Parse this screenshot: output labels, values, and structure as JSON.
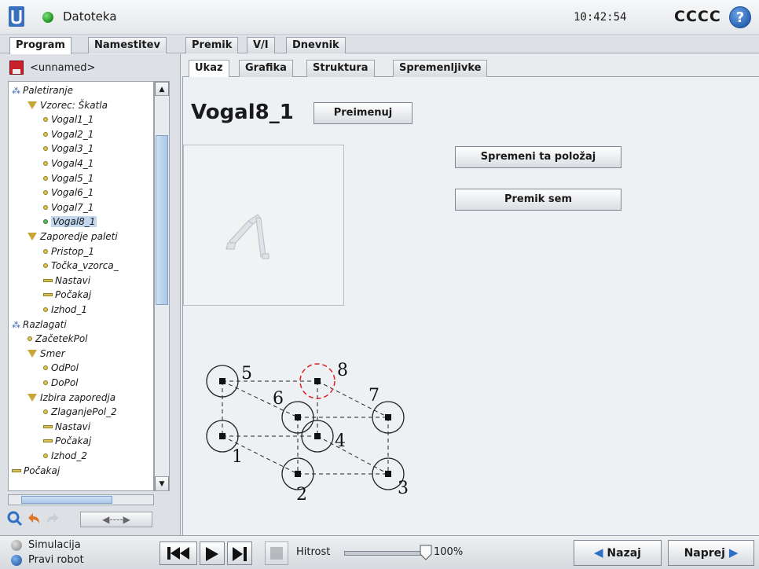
{
  "header": {
    "app_title": "Datoteka",
    "clock": "10:42:54",
    "robot_name": "CCCC",
    "help_label": "?"
  },
  "main_tabs": [
    {
      "label": "Program",
      "active": true
    },
    {
      "label": "Namestitev",
      "active": false
    },
    {
      "label": "Premik",
      "active": false
    },
    {
      "label": "V/I",
      "active": false
    },
    {
      "label": "Dnevnik",
      "active": false
    }
  ],
  "left_panel": {
    "program_name": "<unnamed>",
    "tree": [
      {
        "label": "Paletiranje",
        "type": "node",
        "depth": 0
      },
      {
        "label": "Vzorec: Škatla",
        "type": "folder",
        "depth": 1
      },
      {
        "label": "Vogal1_1",
        "type": "waypoint",
        "depth": 2
      },
      {
        "label": "Vogal2_1",
        "type": "waypoint",
        "depth": 2
      },
      {
        "label": "Vogal3_1",
        "type": "waypoint",
        "depth": 2
      },
      {
        "label": "Vogal4_1",
        "type": "waypoint",
        "depth": 2
      },
      {
        "label": "Vogal5_1",
        "type": "waypoint",
        "depth": 2
      },
      {
        "label": "Vogal6_1",
        "type": "waypoint",
        "depth": 2
      },
      {
        "label": "Vogal7_1",
        "type": "waypoint",
        "depth": 2
      },
      {
        "label": "Vogal8_1",
        "type": "waypoint",
        "depth": 2,
        "selected": true
      },
      {
        "label": "Zaporedje paleti",
        "type": "folder",
        "depth": 1
      },
      {
        "label": "Pristop_1",
        "type": "waypoint",
        "depth": 2
      },
      {
        "label": "Točka_vzorca_",
        "type": "waypoint",
        "depth": 2
      },
      {
        "label": "Nastavi",
        "type": "action",
        "depth": 2
      },
      {
        "label": "Počakaj",
        "type": "action",
        "depth": 2
      },
      {
        "label": "Izhod_1",
        "type": "waypoint",
        "depth": 2
      },
      {
        "label": "Razlagati",
        "type": "node",
        "depth": 0
      },
      {
        "label": "ZačetekPol",
        "type": "waypoint",
        "depth": 1
      },
      {
        "label": "Smer",
        "type": "folder",
        "depth": 1
      },
      {
        "label": "OdPol",
        "type": "waypoint",
        "depth": 2
      },
      {
        "label": "DoPol",
        "type": "waypoint",
        "depth": 2
      },
      {
        "label": "Izbira zaporedja",
        "type": "folder",
        "depth": 1
      },
      {
        "label": "ZlaganjePol_2",
        "type": "waypoint",
        "depth": 2
      },
      {
        "label": "Nastavi",
        "type": "action",
        "depth": 2
      },
      {
        "label": "Počakaj",
        "type": "action",
        "depth": 2
      },
      {
        "label": "Izhod_2",
        "type": "waypoint",
        "depth": 2
      },
      {
        "label": "Počakaj",
        "type": "action",
        "depth": 0
      }
    ],
    "arrows_label": "◀----▶"
  },
  "sub_tabs": [
    {
      "label": "Ukaz",
      "active": true
    },
    {
      "label": "Grafika",
      "active": false
    },
    {
      "label": "Struktura",
      "active": false
    },
    {
      "label": "Spremenljivke",
      "active": false
    }
  ],
  "command": {
    "waypoint_name": "Vogal8_1",
    "rename_label": "Preimenuj",
    "change_position_label": "Spremeni ta položaj",
    "move_here_label": "Premik sem",
    "pattern_numbers": [
      "1",
      "2",
      "3",
      "4",
      "5",
      "6",
      "7",
      "8"
    ]
  },
  "bottom": {
    "simulation_label": "Simulacija",
    "real_robot_label": "Pravi robot",
    "speed_label": "Hitrost",
    "speed_value": "100%",
    "speed_fraction": 1.0,
    "back_label": "Nazaj",
    "next_label": "Naprej"
  },
  "colors": {
    "accent_blue": "#2f6fc4",
    "selected_corner": "#e02020",
    "tree_selection": "#c2d6ee"
  }
}
